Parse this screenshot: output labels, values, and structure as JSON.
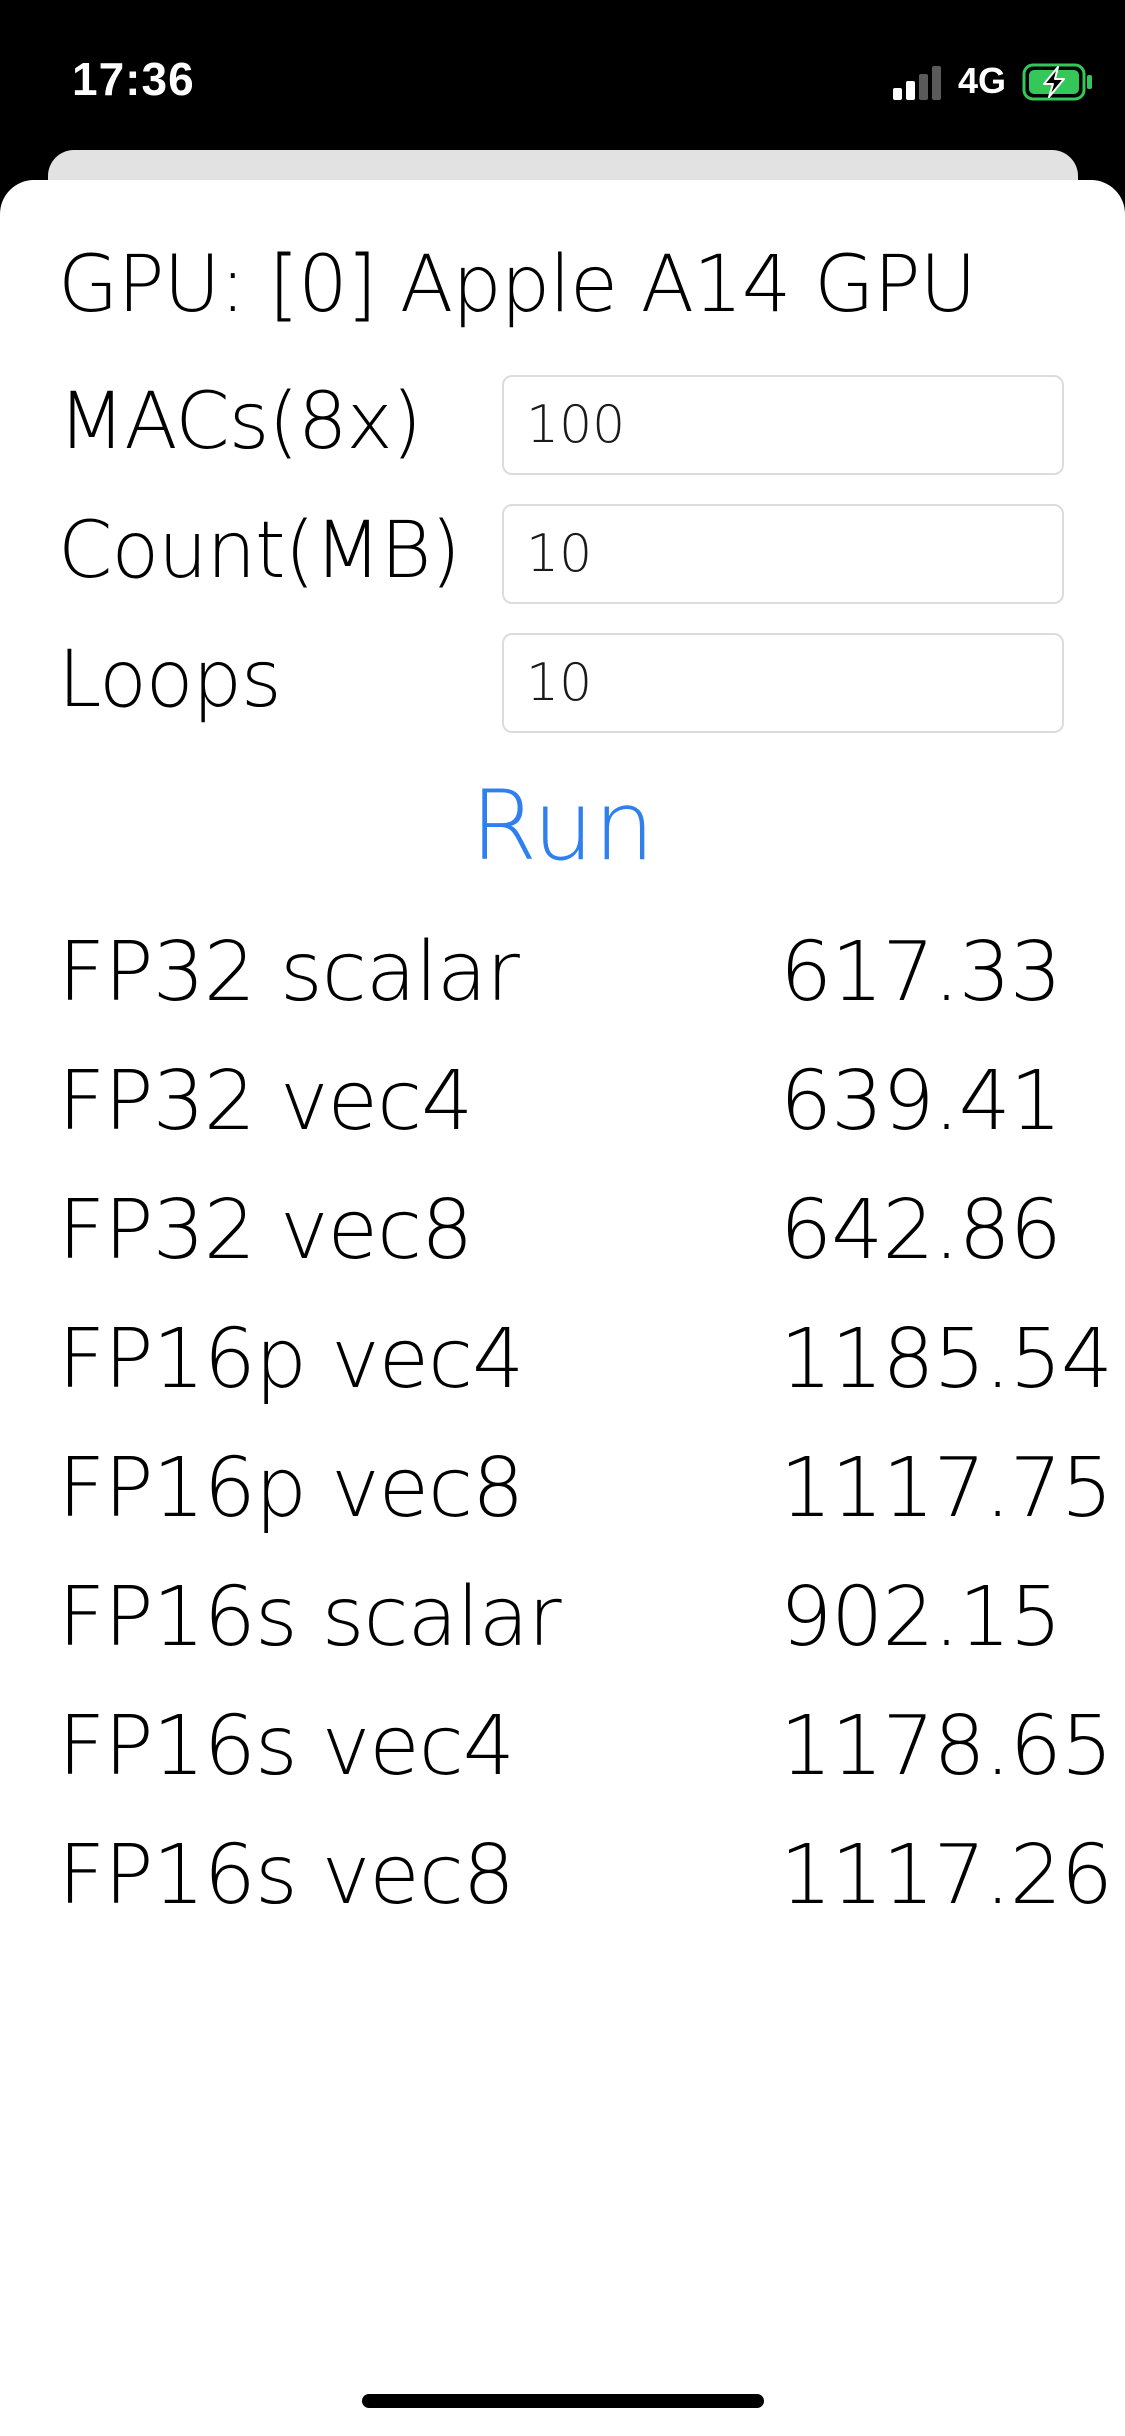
{
  "status_bar": {
    "time": "17:36",
    "network": "4G",
    "signal_icon": "cellular-signal-icon",
    "battery_icon": "battery-charging-icon",
    "battery_color": "#34c759"
  },
  "app": {
    "gpu_label": "GPU: [0] Apple A14 GPU",
    "params": [
      {
        "label": "MACs(8x)",
        "value": "100"
      },
      {
        "label": "Count(MB)",
        "value": "10"
      },
      {
        "label": "Loops",
        "value": "10"
      }
    ],
    "run_label": "Run",
    "accent_color": "#2f80ed",
    "results": [
      {
        "name": "FP32 scalar",
        "value": "617.33"
      },
      {
        "name": "FP32 vec4",
        "value": "639.41"
      },
      {
        "name": "FP32 vec8",
        "value": "642.86"
      },
      {
        "name": "FP16p vec4",
        "value": "1185.54"
      },
      {
        "name": "FP16p vec8",
        "value": "1117.75"
      },
      {
        "name": "FP16s scalar",
        "value": "902.15"
      },
      {
        "name": "FP16s vec4",
        "value": "1178.65"
      },
      {
        "name": "FP16s vec8",
        "value": "1117.26"
      }
    ]
  }
}
